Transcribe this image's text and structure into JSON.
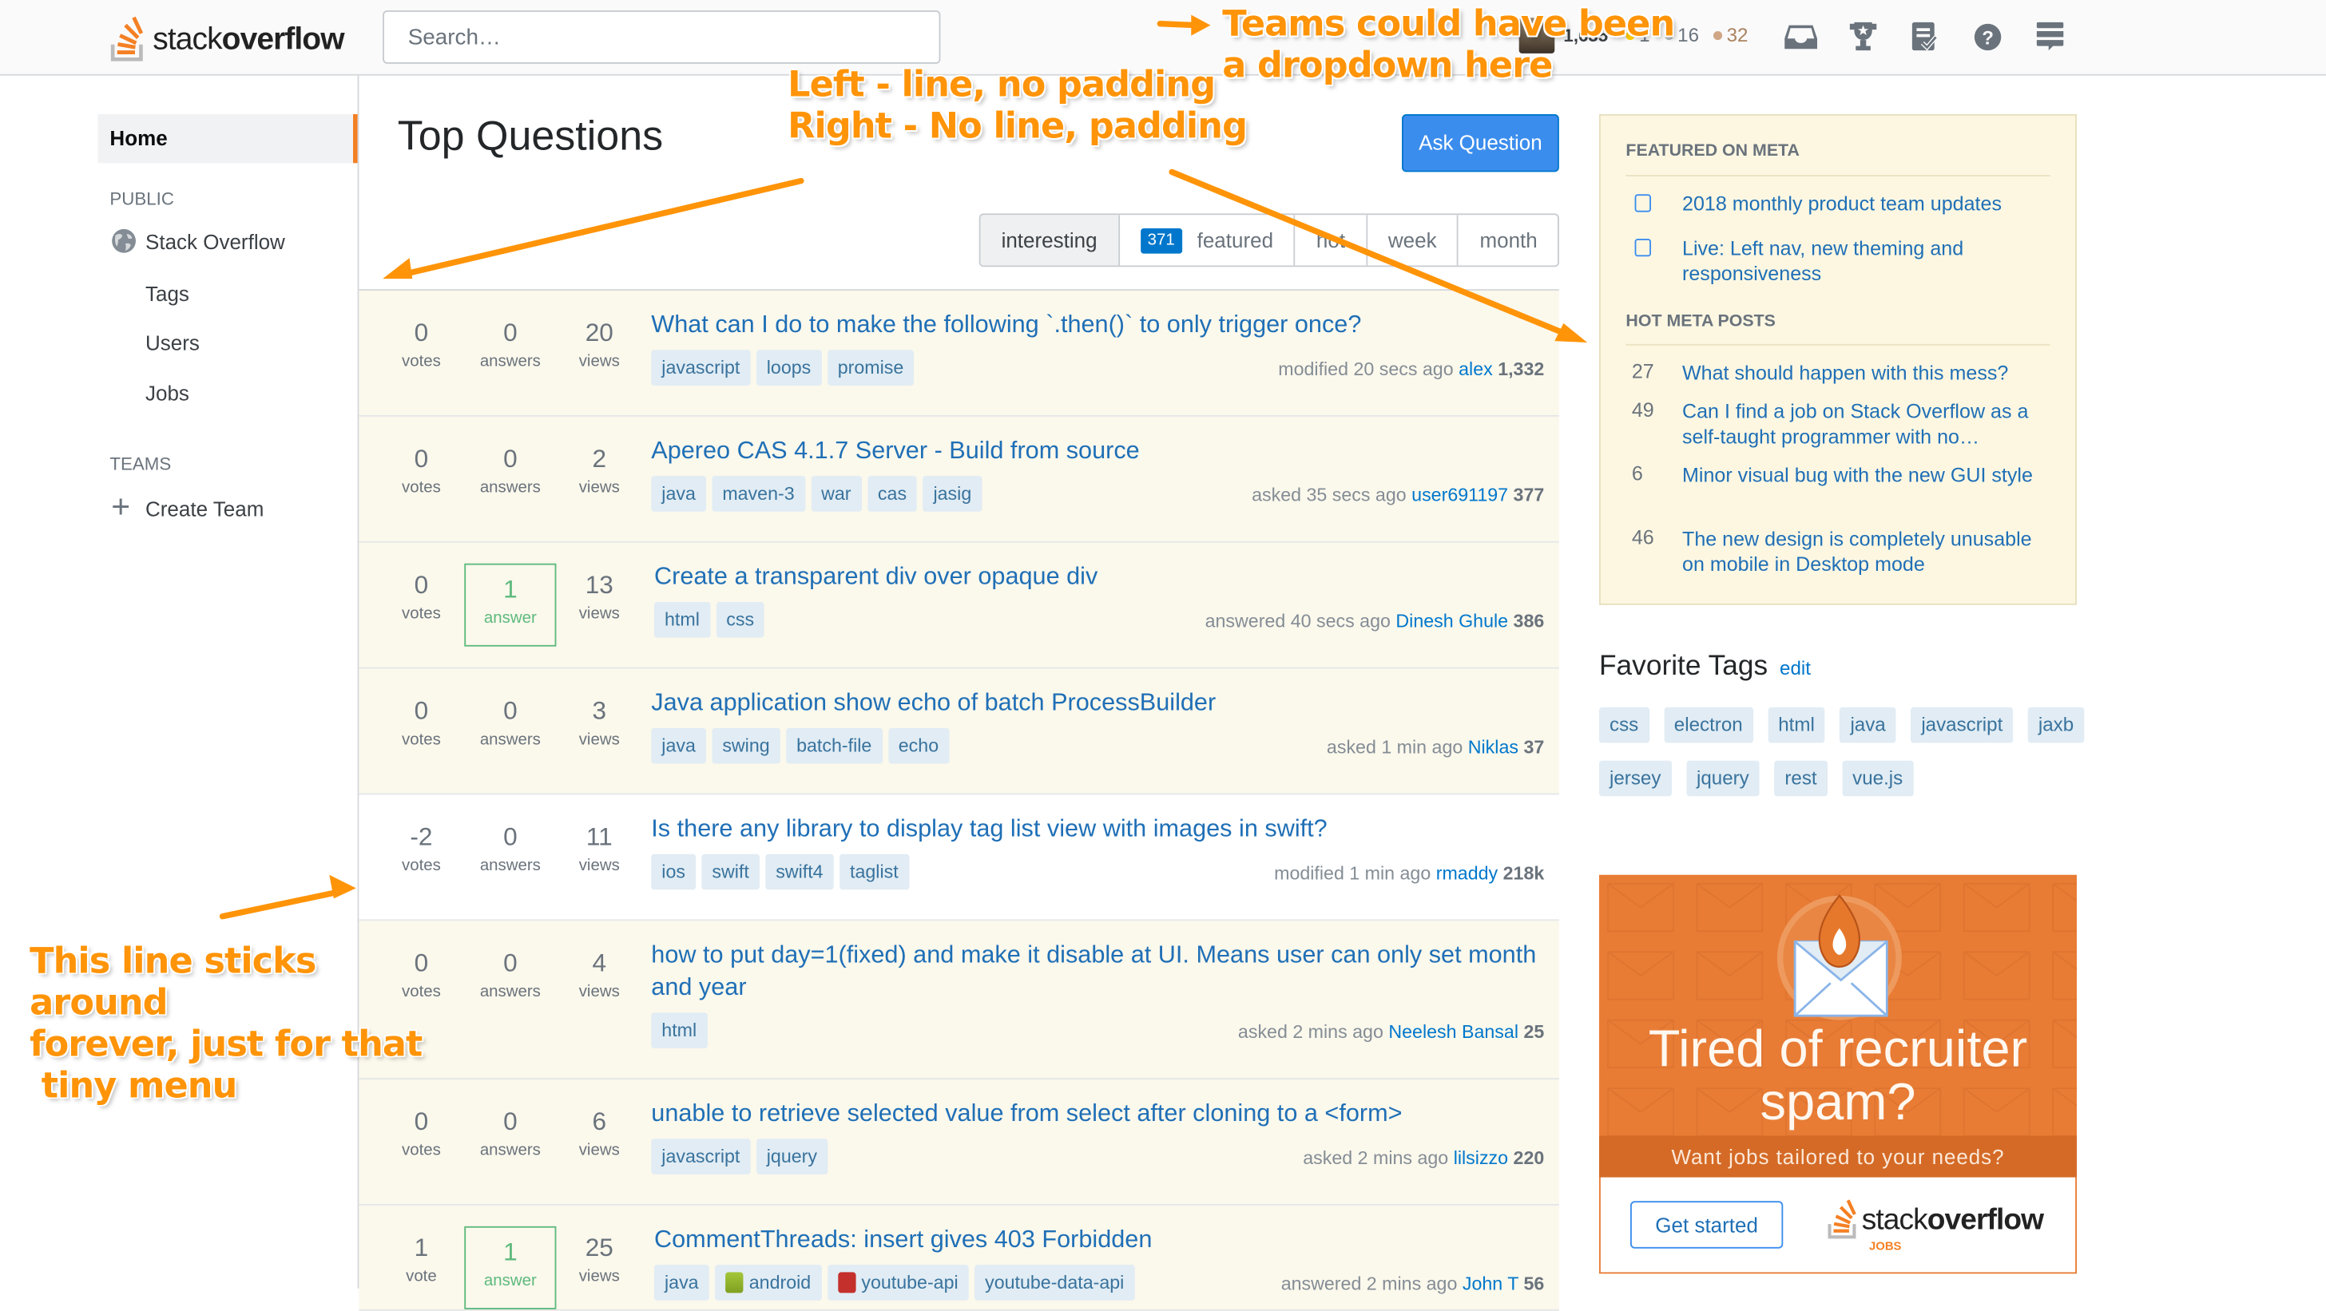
{
  "topbar": {
    "logo_text_light": "stack",
    "logo_text_bold": "overflow",
    "search_placeholder": "Search…",
    "reputation": "1,635",
    "badges": {
      "gold": "1",
      "silver": "16",
      "bronze": "32"
    },
    "icons": [
      "inbox-icon",
      "achievements-icon",
      "review-icon",
      "help-icon",
      "site-switcher-icon"
    ],
    "colors": {
      "gold": "#ffcc01",
      "silver": "#b4b8bc",
      "bronze": "#d1a684"
    }
  },
  "leftnav": {
    "home": "Home",
    "public_label": "PUBLIC",
    "stack_overflow": "Stack Overflow",
    "tags": "Tags",
    "users": "Users",
    "jobs": "Jobs",
    "teams_label": "TEAMS",
    "create_team": "Create Team"
  },
  "main": {
    "title": "Top Questions",
    "ask_button": "Ask Question",
    "filters": [
      {
        "label": "interesting",
        "active": true
      },
      {
        "label": "featured",
        "count": "371"
      },
      {
        "label": "hot"
      },
      {
        "label": "week"
      },
      {
        "label": "month"
      }
    ],
    "questions": [
      {
        "votes": "0",
        "votes_label": "votes",
        "answers": "0",
        "answers_label": "answers",
        "answered": false,
        "views": "20",
        "views_label": "views",
        "title": "What can I do to make the following `.then()` to only trigger once?",
        "tags": [
          "javascript",
          "loops",
          "promise"
        ],
        "action": "modified 20 secs ago",
        "user": "alex",
        "rep": "1,332",
        "highlight": true
      },
      {
        "votes": "0",
        "votes_label": "votes",
        "answers": "0",
        "answers_label": "answers",
        "answered": false,
        "views": "2",
        "views_label": "views",
        "title": "Apereo CAS 4.1.7 Server - Build from source",
        "tags": [
          "java",
          "maven-3",
          "war",
          "cas",
          "jasig"
        ],
        "action": "asked 35 secs ago",
        "user": "user691197",
        "rep": "377",
        "highlight": true
      },
      {
        "votes": "0",
        "votes_label": "votes",
        "answers": "1",
        "answers_label": "answer",
        "answered": true,
        "views": "13",
        "views_label": "views",
        "title": "Create a transparent div over opaque div",
        "tags": [
          "html",
          "css"
        ],
        "action": "answered 40 secs ago",
        "user": "Dinesh Ghule",
        "rep": "386",
        "highlight": true
      },
      {
        "votes": "0",
        "votes_label": "votes",
        "answers": "0",
        "answers_label": "answers",
        "answered": false,
        "views": "3",
        "views_label": "views",
        "title": "Java application show echo of batch ProcessBuilder",
        "tags": [
          "java",
          "swing",
          "batch-file",
          "echo"
        ],
        "action": "asked 1 min ago",
        "user": "Niklas",
        "rep": "37",
        "highlight": true
      },
      {
        "votes": "-2",
        "votes_label": "votes",
        "answers": "0",
        "answers_label": "answers",
        "answered": false,
        "views": "11",
        "views_label": "views",
        "title": "Is there any library to display tag list view with images in swift?",
        "tags": [
          "ios",
          "swift",
          "swift4",
          "taglist"
        ],
        "action": "modified 1 min ago",
        "user": "rmaddy",
        "rep": "218k",
        "highlight": false
      },
      {
        "votes": "0",
        "votes_label": "votes",
        "answers": "0",
        "answers_label": "answers",
        "answered": false,
        "views": "4",
        "views_label": "views",
        "title": "how to put day=1(fixed) and make it disable at UI. Means user can only set month and year",
        "tags": [
          "html"
        ],
        "action": "asked 2 mins ago",
        "user": "Neelesh Bansal",
        "rep": "25",
        "highlight": true
      },
      {
        "votes": "0",
        "votes_label": "votes",
        "answers": "0",
        "answers_label": "answers",
        "answered": false,
        "views": "6",
        "views_label": "views",
        "title": "unable to retrieve selected value from select after cloning to a <form>",
        "tags": [
          "javascript",
          "jquery"
        ],
        "action": "asked 2 mins ago",
        "user": "lilsizzo",
        "rep": "220",
        "highlight": true
      },
      {
        "votes": "1",
        "votes_label": "vote",
        "answers": "1",
        "answers_label": "answer",
        "answered": true,
        "views": "25",
        "views_label": "views",
        "title": "CommentThreads: insert gives 403 Forbidden",
        "tags": [
          "java",
          "android",
          "youtube-api",
          "youtube-data-api"
        ],
        "tag_icons": {
          "android": "android-icon",
          "youtube-api": "youtube-icon"
        },
        "action": "answered 2 mins ago",
        "user": "John T",
        "rep": "56",
        "highlight": true
      }
    ]
  },
  "sidebar": {
    "featured_heading": "FEATURED ON META",
    "featured": [
      {
        "icon": "meta-chat-icon",
        "title": "2018 monthly product team updates"
      },
      {
        "icon": "meta-chat-icon",
        "title": "Live: Left nav, new theming and responsiveness"
      }
    ],
    "hot_heading": "HOT META POSTS",
    "hot": [
      {
        "score": "27",
        "title": "What should happen with this mess?"
      },
      {
        "score": "49",
        "title": "Can I find a job on Stack Overflow as a self-taught programmer with no…"
      },
      {
        "score": "6",
        "title": "Minor visual bug with the new GUI style"
      },
      {
        "score": "46",
        "title": "The new design is completely unusable on mobile in Desktop mode"
      }
    ],
    "favorite_tags_heading": "Favorite Tags",
    "favorite_tags_edit": "edit",
    "favorite_tags": [
      "css",
      "electron",
      "html",
      "java",
      "javascript",
      "jaxb",
      "jersey",
      "jquery",
      "rest",
      "vue.js"
    ],
    "ad": {
      "headline": "Tired of recruiter spam?",
      "subline": "Want jobs tailored to your needs?",
      "cta": "Get started",
      "brand_light": "stack",
      "brand_bold": "overflow",
      "brand_sub": "JOBS"
    }
  },
  "annotations": {
    "teams": "Teams could have been\na dropdown here",
    "padding": "Left - line, no padding\nRight - No line, padding",
    "line": "This line sticks\naround\nforever, just for that\n tiny menu",
    "color": "#ff9408"
  }
}
